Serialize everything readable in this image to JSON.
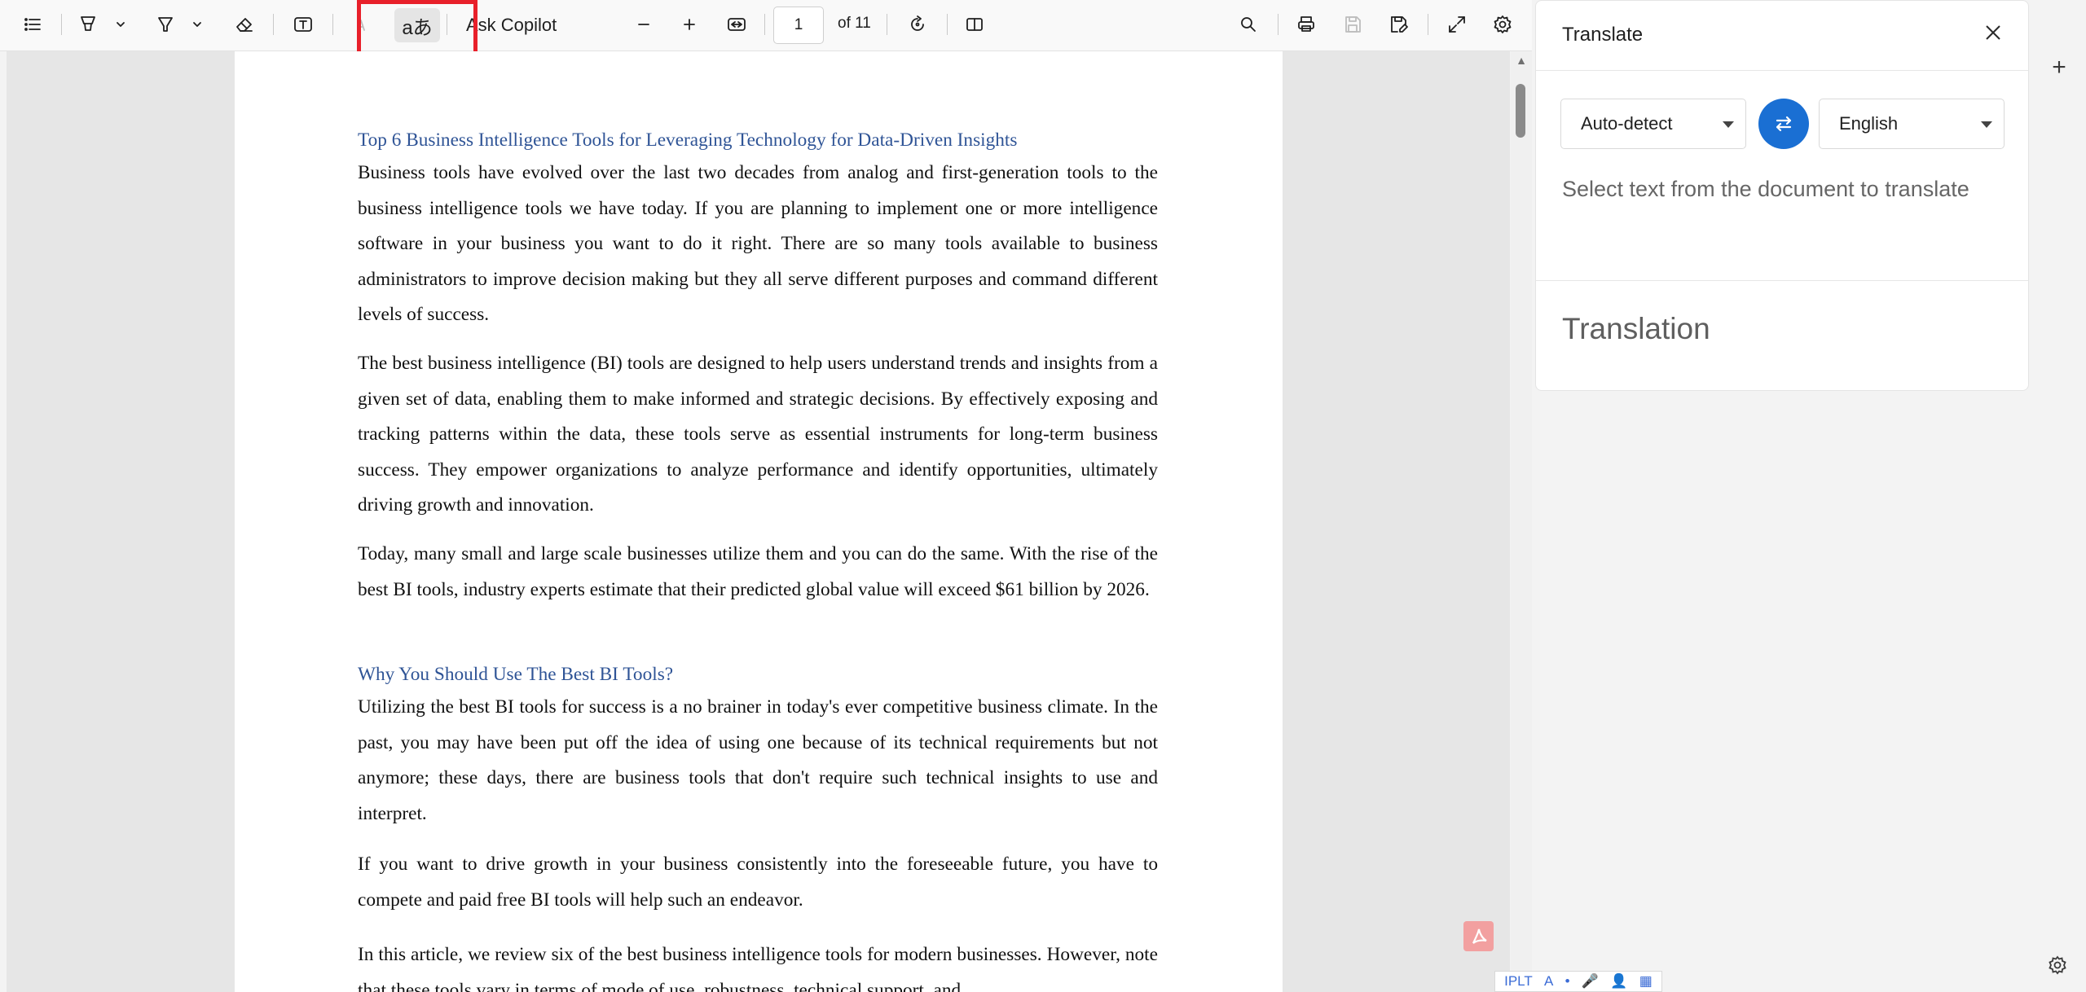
{
  "toolbar": {
    "translate_icon_text": "aあ",
    "ask_copilot": "Ask Copilot",
    "page_number": "1",
    "page_total": "of 11"
  },
  "document": {
    "heading1": "Top 6 Business Intelligence Tools for Leveraging Technology for Data-Driven Insights",
    "p1": "Business tools have evolved over the last two decades from analog and first-generation tools to the business intelligence tools we have today.  If you are planning to implement one or more intelligence software in your business you want to do it right. There are so many tools available to business administrators to improve decision making but they all serve different purposes and command different levels of success.",
    "p2": "The best business intelligence (BI) tools are designed to help users understand trends and insights from a given set of data, enabling them to make informed and strategic decisions. By effectively exposing and tracking patterns within the data, these tools serve as essential instruments for long-term business success. They empower organizations to analyze performance and identify opportunities, ultimately driving growth and innovation.",
    "p3": "Today, many small and large scale businesses utilize them and you can do the same. With the rise of the best BI tools, industry experts estimate that their predicted global value will exceed $61 billion by 2026.",
    "heading2": "Why You Should Use The Best BI Tools?",
    "p4": "Utilizing the best BI tools for success is a no brainer in today's ever competitive business climate. In the past, you may have been put off the idea of using one because of its technical requirements but not anymore; these days, there are business tools that don't require such technical insights to use and interpret.",
    "p5": "If you want to drive growth in your business consistently into the foreseeable future, you have to compete and paid free BI tools will help such an endeavor.",
    "p6": "In this article, we review six of the best business intelligence tools for modern businesses. However, note that these tools vary in terms of mode of use, robustness, technical support, and"
  },
  "translate_panel": {
    "title": "Translate",
    "source_language": "Auto-detect",
    "target_language": "English",
    "hint": "Select text from the document to translate",
    "translation_label": "Translation"
  },
  "mini_bar": {
    "items": [
      "IPLT",
      "A",
      "•",
      "🎤",
      "👤",
      "▦"
    ]
  },
  "colors": {
    "heading": "#2f5496",
    "highlight": "#e8202a",
    "swap_button": "#1a6fd3"
  },
  "icons": [
    "contents-icon",
    "draw-icon",
    "highlight-icon",
    "eraser-icon",
    "text-box-icon",
    "read-aloud-icon",
    "translate-icon",
    "zoom-out-icon",
    "zoom-in-icon",
    "fit-width-icon",
    "rotate-icon",
    "page-view-icon",
    "search-icon",
    "print-icon",
    "save-icon",
    "save-as-icon",
    "fullscreen-icon",
    "settings-icon"
  ]
}
